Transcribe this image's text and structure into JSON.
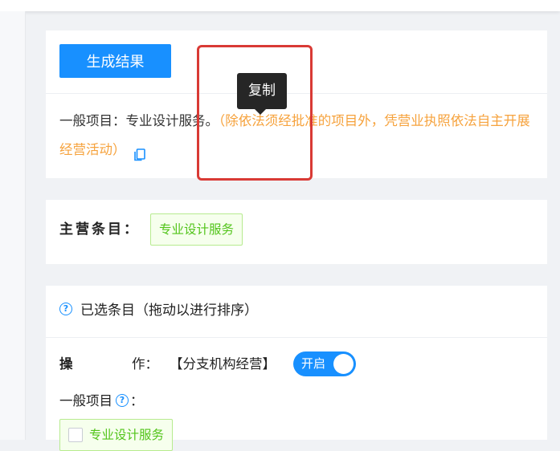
{
  "result_card": {
    "generate_button_label": "生成结果",
    "scope_main": "一般项目：专业设计服务。",
    "scope_note": "（除依法须经批准的项目外，凭营业执照依法自主开展经营活动）",
    "copy_tooltip": "复制",
    "copy_icon": "copy-icon"
  },
  "main_item_card": {
    "label": "主营条目：",
    "tag": "专业设计服务"
  },
  "selected_card": {
    "header": "已选条目（拖动以进行排序）",
    "help_icon": "question-circle-icon",
    "operation_label_a": "操",
    "operation_label_b": "作：",
    "operation_text": "【分支机构经营】",
    "switch_label": "开启",
    "switch_on": true,
    "general_label": "一般项目",
    "general_colon": "：",
    "item_tag": "专业设计服务"
  },
  "colors": {
    "primary": "#1890ff",
    "note_orange": "#f6a23c",
    "tag_green": "#52c41a",
    "highlight_red": "#d93a35"
  }
}
